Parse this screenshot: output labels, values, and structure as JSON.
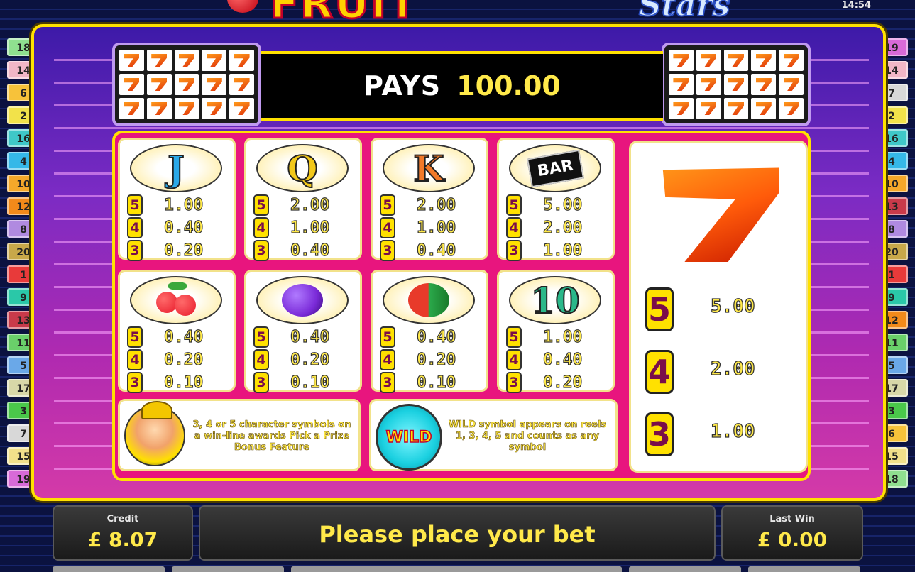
{
  "header": {
    "logo_text": "FRUIT",
    "logo_sub": "Stars",
    "clock": "14:54"
  },
  "lines_left": [
    {
      "n": "18",
      "color": "#8fe08f"
    },
    {
      "n": "14",
      "color": "#f2b6c6"
    },
    {
      "n": "6",
      "color": "#f7c23a"
    },
    {
      "n": "2",
      "color": "#f2e24a"
    },
    {
      "n": "16",
      "color": "#3fc8c8"
    },
    {
      "n": "4",
      "color": "#35b8e8"
    },
    {
      "n": "10",
      "color": "#f5a82a"
    },
    {
      "n": "12",
      "color": "#f28a1a"
    },
    {
      "n": "8",
      "color": "#b08ae0"
    },
    {
      "n": "20",
      "color": "#c8a84a"
    },
    {
      "n": "1",
      "color": "#e83a3a"
    },
    {
      "n": "9",
      "color": "#2ac8a8"
    },
    {
      "n": "13",
      "color": "#c83a4a"
    },
    {
      "n": "11",
      "color": "#6ad06a"
    },
    {
      "n": "5",
      "color": "#6aa8e8"
    },
    {
      "n": "17",
      "color": "#d8d8a8"
    },
    {
      "n": "3",
      "color": "#4ac84a"
    },
    {
      "n": "7",
      "color": "#d8d8d8"
    },
    {
      "n": "15",
      "color": "#f2e08a"
    },
    {
      "n": "19",
      "color": "#d86ad8"
    }
  ],
  "lines_right": [
    {
      "n": "19",
      "color": "#d86ad8"
    },
    {
      "n": "14",
      "color": "#f2b6c6"
    },
    {
      "n": "7",
      "color": "#d8d8d8"
    },
    {
      "n": "2",
      "color": "#f2e24a"
    },
    {
      "n": "16",
      "color": "#3fc8c8"
    },
    {
      "n": "4",
      "color": "#35b8e8"
    },
    {
      "n": "10",
      "color": "#f5a82a"
    },
    {
      "n": "13",
      "color": "#c83a4a"
    },
    {
      "n": "8",
      "color": "#b08ae0"
    },
    {
      "n": "20",
      "color": "#c8a84a"
    },
    {
      "n": "1",
      "color": "#e83a3a"
    },
    {
      "n": "9",
      "color": "#2ac8a8"
    },
    {
      "n": "12",
      "color": "#f28a1a"
    },
    {
      "n": "11",
      "color": "#6ad06a"
    },
    {
      "n": "5",
      "color": "#6aa8e8"
    },
    {
      "n": "17",
      "color": "#d8d8a8"
    },
    {
      "n": "3",
      "color": "#4ac84a"
    },
    {
      "n": "6",
      "color": "#f7c23a"
    },
    {
      "n": "15",
      "color": "#f2e08a"
    },
    {
      "n": "18",
      "color": "#8fe08f"
    }
  ],
  "pays": {
    "label": "PAYS",
    "value": "100.00"
  },
  "paytable": {
    "symbols": [
      {
        "symbol": "J",
        "icon": "letter-j",
        "color": "#2aa8e8",
        "pays": [
          {
            "count": "5",
            "amount": "1.00"
          },
          {
            "count": "4",
            "amount": "0.40"
          },
          {
            "count": "3",
            "amount": "0.20"
          }
        ]
      },
      {
        "symbol": "Q",
        "icon": "letter-q",
        "color": "#f2c81a",
        "pays": [
          {
            "count": "5",
            "amount": "2.00"
          },
          {
            "count": "4",
            "amount": "1.00"
          },
          {
            "count": "3",
            "amount": "0.40"
          }
        ]
      },
      {
        "symbol": "K",
        "icon": "letter-k",
        "color": "#f27a2a",
        "pays": [
          {
            "count": "5",
            "amount": "2.00"
          },
          {
            "count": "4",
            "amount": "1.00"
          },
          {
            "count": "3",
            "amount": "0.40"
          }
        ]
      },
      {
        "symbol": "BAR",
        "icon": "bar",
        "color": "#111111",
        "pays": [
          {
            "count": "5",
            "amount": "5.00"
          },
          {
            "count": "4",
            "amount": "2.00"
          },
          {
            "count": "3",
            "amount": "1.00"
          }
        ]
      },
      {
        "symbol": "",
        "icon": "cherry",
        "color": "#e81a2a",
        "pays": [
          {
            "count": "5",
            "amount": "0.40"
          },
          {
            "count": "4",
            "amount": "0.20"
          },
          {
            "count": "3",
            "amount": "0.10"
          }
        ]
      },
      {
        "symbol": "",
        "icon": "plum",
        "color": "#7a2ad8",
        "pays": [
          {
            "count": "5",
            "amount": "0.40"
          },
          {
            "count": "4",
            "amount": "0.20"
          },
          {
            "count": "3",
            "amount": "0.10"
          }
        ]
      },
      {
        "symbol": "",
        "icon": "watermelon",
        "color": "#2aa84a",
        "pays": [
          {
            "count": "5",
            "amount": "0.40"
          },
          {
            "count": "4",
            "amount": "0.20"
          },
          {
            "count": "3",
            "amount": "0.10"
          }
        ]
      },
      {
        "symbol": "10",
        "icon": "number-10",
        "color": "#2ab88a",
        "pays": [
          {
            "count": "5",
            "amount": "1.00"
          },
          {
            "count": "4",
            "amount": "0.40"
          },
          {
            "count": "3",
            "amount": "0.20"
          }
        ]
      }
    ],
    "seven": {
      "icon": "seven",
      "pays": [
        {
          "count": "5",
          "amount": "5.00"
        },
        {
          "count": "4",
          "amount": "2.00"
        },
        {
          "count": "3",
          "amount": "1.00"
        }
      ]
    },
    "bonus_text": "3, 4 or 5 character symbols on a win-line awards Pick a Prize Bonus Feature",
    "wild_label": "WILD",
    "wild_text": "WILD symbol appears on reels 1, 3, 4, 5 and counts as any symbol"
  },
  "bottom": {
    "credit_label": "Credit",
    "credit_value": "£ 8.07",
    "message": "Please place your bet",
    "last_win_label": "Last Win",
    "last_win_value": "£ 0.00"
  }
}
